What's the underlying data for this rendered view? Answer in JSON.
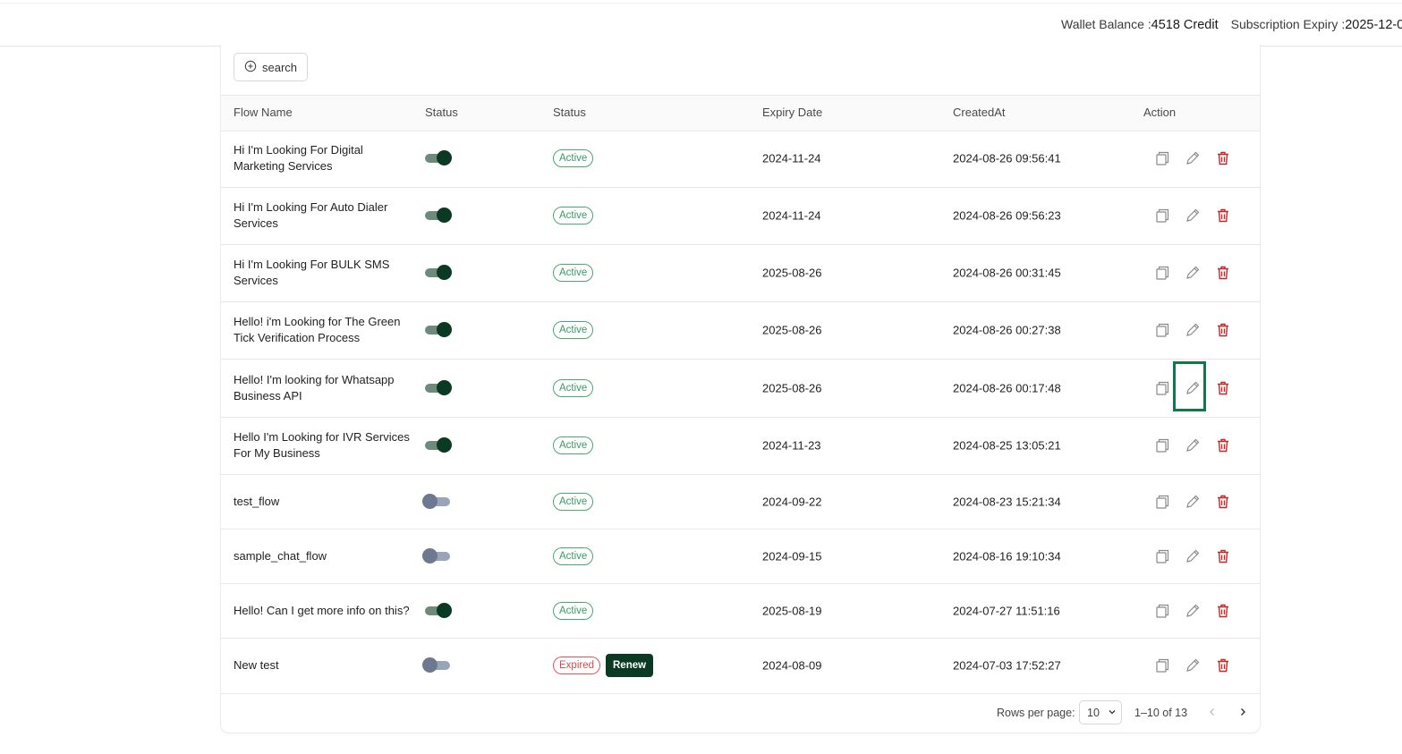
{
  "header": {
    "wallet_label": "Wallet Balance :",
    "wallet_value": "4518 Credit",
    "subscription_label": "Subscription Expiry :",
    "subscription_value": "2025-12-0"
  },
  "toolbar": {
    "search_label": "search"
  },
  "table": {
    "columns": [
      "Flow Name",
      "Status",
      "Status",
      "Expiry Date",
      "CreatedAt",
      "Action"
    ],
    "rows": [
      {
        "name": "Hi I'm Looking For Digital Marketing Services",
        "enabled": true,
        "status": "Active",
        "expiry": "2024-11-24",
        "created": "2024-08-26 09:56:41"
      },
      {
        "name": "Hi I'm Looking For Auto Dialer Services",
        "enabled": true,
        "status": "Active",
        "expiry": "2024-11-24",
        "created": "2024-08-26 09:56:23"
      },
      {
        "name": "Hi I'm Looking For BULK SMS Services",
        "enabled": true,
        "status": "Active",
        "expiry": "2025-08-26",
        "created": "2024-08-26 00:31:45"
      },
      {
        "name": "Hello! i'm Looking for The Green Tick Verification Process",
        "enabled": true,
        "status": "Active",
        "expiry": "2025-08-26",
        "created": "2024-08-26 00:27:38"
      },
      {
        "name": "Hello! I'm looking for Whatsapp Business API",
        "enabled": true,
        "status": "Active",
        "expiry": "2025-08-26",
        "created": "2024-08-26 00:17:48"
      },
      {
        "name": "Hello I'm Looking for IVR Services For My Business",
        "enabled": true,
        "status": "Active",
        "expiry": "2024-11-23",
        "created": "2024-08-25 13:05:21"
      },
      {
        "name": "test_flow",
        "enabled": false,
        "status": "Active",
        "expiry": "2024-09-22",
        "created": "2024-08-23 15:21:34"
      },
      {
        "name": "sample_chat_flow",
        "enabled": false,
        "status": "Active",
        "expiry": "2024-09-15",
        "created": "2024-08-16 19:10:34"
      },
      {
        "name": "Hello! Can I get more info on this?",
        "enabled": true,
        "status": "Active",
        "expiry": "2025-08-19",
        "created": "2024-07-27 11:51:16"
      },
      {
        "name": "New test",
        "enabled": false,
        "status": "Expired",
        "renew_label": "Renew",
        "expiry": "2024-08-09",
        "created": "2024-07-03 17:52:27"
      }
    ]
  },
  "pagination": {
    "rows_per_page_label": "Rows per page:",
    "rows_per_page_value": "10",
    "range_label": "1–10 of 13"
  },
  "icons": {
    "search": "circle-plus-icon",
    "copy": "copy-icon",
    "edit": "pencil-icon",
    "delete": "trash-icon",
    "prev": "chevron-left-icon",
    "next": "chevron-right-icon",
    "dropdown": "chevron-down-icon"
  },
  "colors": {
    "toggle_on_knob": "#0b3a24",
    "active_badge": "#3a9a66",
    "expired_badge": "#d84a4a",
    "delete_icon": "#c62828",
    "renew_button": "#0b3a24",
    "highlight": "#0e7a4a"
  }
}
